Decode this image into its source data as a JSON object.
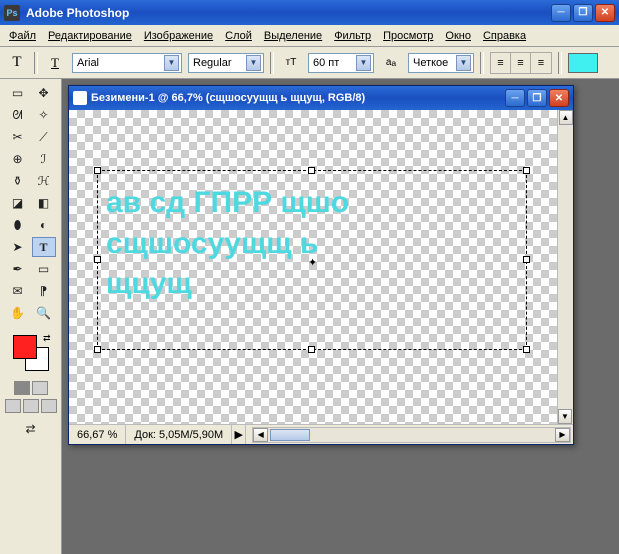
{
  "titlebar": {
    "title": "Adobe Photoshop"
  },
  "menu": [
    "Файл",
    "Редактирование",
    "Изображение",
    "Слой",
    "Выделение",
    "Фильтр",
    "Просмотр",
    "Окно",
    "Справка"
  ],
  "options": {
    "font_family": "Arial",
    "font_style": "Regular",
    "font_size": "60 пт",
    "aa_label": "Четкое",
    "color": "#40f0f0"
  },
  "toolbox": {
    "fg": "#ff2020",
    "tools": [
      "move",
      "marquee",
      "lasso",
      "wand",
      "crop",
      "slice",
      "heal",
      "brush",
      "stamp",
      "history",
      "eraser",
      "gradient",
      "blur",
      "dodge",
      "path",
      "type",
      "pen",
      "shape",
      "notes",
      "eyedrop",
      "hand",
      "zoom"
    ]
  },
  "doc": {
    "title": "Безимени-1 @ 66,7% (сщшосуущщ ь щцущ, RGB/8)",
    "text_lines": [
      "ав сд ГПРР щшо",
      "сщшосуущщ ь",
      "щцущ"
    ],
    "zoom": "66,67 %",
    "docinfo": "Док: 5,05M/5,90M"
  }
}
